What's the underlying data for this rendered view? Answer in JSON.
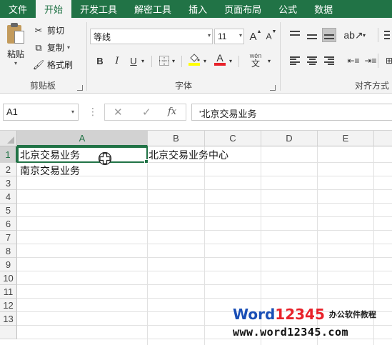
{
  "ribbon_tabs": [
    "文件",
    "开始",
    "开发工具",
    "解密工具",
    "插入",
    "页面布局",
    "公式",
    "数据"
  ],
  "active_tab": "开始",
  "clipboard": {
    "paste_label": "粘贴",
    "cut_label": "剪切",
    "copy_label": "复制",
    "format_painter_label": "格式刷",
    "group_label": "剪贴板"
  },
  "font": {
    "font_name": "等线",
    "font_size": "11",
    "grow_label": "A",
    "shrink_label": "A",
    "bold_label": "B",
    "italic_label": "I",
    "underline_label": "U",
    "font_color_label": "A",
    "wen_label": "wén",
    "wen_sub": "文",
    "group_label": "字体",
    "highlight_color": "#ffff00",
    "font_color": "#e8222a"
  },
  "alignment": {
    "group_label": "对齐方式"
  },
  "formula_bar": {
    "name_box": "A1",
    "cancel_icon": "✕",
    "enter_icon": "✓",
    "fx_label": "fx",
    "content": "'北京交易业务"
  },
  "grid": {
    "columns": [
      "A",
      "B",
      "C",
      "D",
      "E"
    ],
    "rows": [
      "1",
      "2",
      "3",
      "4",
      "5",
      "6",
      "7",
      "8",
      "9",
      "10",
      "11",
      "12",
      "13"
    ],
    "cells": {
      "A1": "北京交易业务",
      "A2": "南京交易业务",
      "B1": "北京交易业务中心"
    },
    "active_cell": "A1"
  },
  "watermark": {
    "word": "Word",
    "number": "12345",
    "subtitle": "办公软件教程",
    "url": "www.word12345.com"
  },
  "colors": {
    "accent": "#217346",
    "watermark_blue": "#1a4fb6",
    "watermark_red": "#e8222a"
  }
}
